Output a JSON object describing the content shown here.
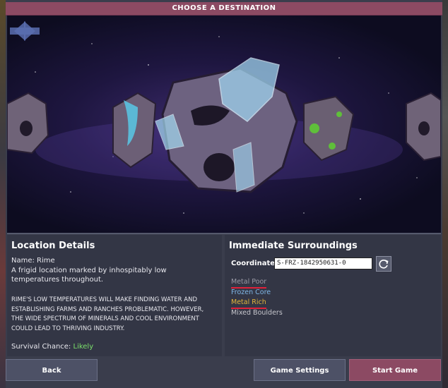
{
  "dialog": {
    "title": "CHOOSE A DESTINATION"
  },
  "nav": {
    "prev_icon": "arrow-left-icon",
    "next_icon": "arrow-right-icon"
  },
  "location": {
    "heading": "Location Details",
    "name": "Name: Rime",
    "description": "A frigid location marked by inhospitably low temperatures throughout.",
    "details": "RIME'S LOW TEMPERATURES WILL MAKE FINDING WATER AND ESTABLISHING FARMS AND RANCHES PROBLEMATIC. HOWEVER, THE WIDE SPECTRUM OF MINERALS AND COOL ENVIRONMENT COULD LEAD TO THRIVING INDUSTRY.",
    "survival_label": "Survival Chance:",
    "survival_value": "Likely"
  },
  "surroundings": {
    "heading": "Immediate Surroundings",
    "coordinates_label": "Coordinates:",
    "coordinates_value": "S-FRZ-1842950631-0",
    "refresh_icon": "refresh-icon",
    "traits": [
      {
        "label": "Metal Poor",
        "color": "#9a9aa6",
        "underline": true
      },
      {
        "label": "Frozen Core",
        "color": "#7fb7e6",
        "underline": false
      },
      {
        "label": "Metal Rich",
        "color": "#e3b53a",
        "underline": true
      },
      {
        "label": "Mixed Boulders",
        "color": "#c6c6cc",
        "underline": false
      }
    ]
  },
  "buttons": {
    "back": "Back",
    "settings": "Game Settings",
    "start": "Start Game"
  },
  "colors": {
    "title_bar": "#8c4a63",
    "panel": "#333645",
    "accent_start": "#8c4a63",
    "survival": "#7be06b"
  }
}
